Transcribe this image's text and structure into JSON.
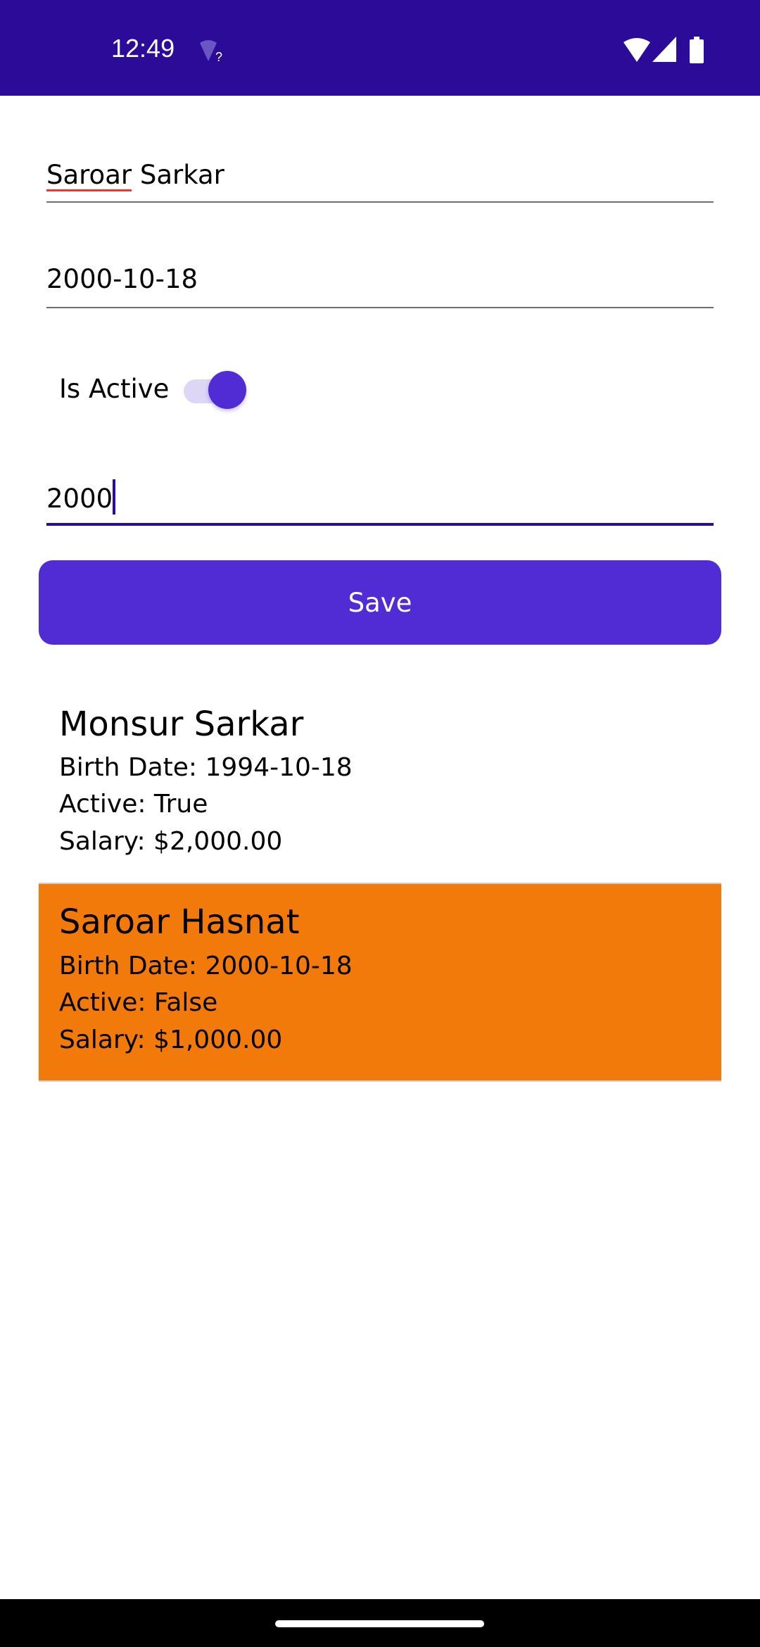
{
  "status_bar": {
    "time": "12:49",
    "icons": [
      "wifi-unknown-icon",
      "wifi-icon",
      "signal-icon",
      "battery-icon"
    ],
    "color": "#2B0B98"
  },
  "form": {
    "name_first": "Saroar",
    "name_rest": " Sarkar",
    "birth_date": "2000-10-18",
    "is_active_label": "Is Active",
    "is_active": true,
    "salary": "2000",
    "save_label": "Save"
  },
  "list": [
    {
      "name": "Monsur Sarkar",
      "birth": "Birth Date: 1994-10-18",
      "active": "Active: True",
      "salary": "Salary: $2,000.00"
    },
    {
      "name": "Saroar Hasnat",
      "birth": "Birth Date: 2000-10-18",
      "active": "Active: False",
      "salary": "Salary: $1,000.00",
      "selected": true,
      "highlight": "#F27A0A"
    }
  ],
  "accent": "#512BD4"
}
